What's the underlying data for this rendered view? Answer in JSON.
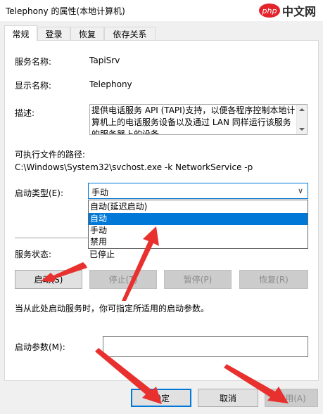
{
  "window": {
    "title": "Telephony 的属性(本地计算机)",
    "watermark": {
      "logo": "php",
      "text": "中文网"
    }
  },
  "tabs": [
    {
      "label": "常规",
      "active": true
    },
    {
      "label": "登录",
      "active": false
    },
    {
      "label": "恢复",
      "active": false
    },
    {
      "label": "依存关系",
      "active": false
    }
  ],
  "general": {
    "service_name_label": "服务名称:",
    "service_name": "TapiSrv",
    "display_name_label": "显示名称:",
    "display_name": "Telephony",
    "description_label": "描述:",
    "description": "提供电话服务 API (TAPI)支持，以便各程序控制本地计算机上的电话服务设备以及通过 LAN 同样运行该服务的服务器上的设备",
    "exe_path_label": "可执行文件的路径:",
    "exe_path": "C:\\Windows\\System32\\svchost.exe -k NetworkService -p",
    "startup_type_label": "启动类型(E):",
    "startup_type_value": "手动",
    "startup_options": [
      "自动(延迟启动)",
      "自动",
      "手动",
      "禁用"
    ],
    "startup_highlighted": "自动",
    "service_status_label": "服务状态:",
    "service_status": "已停止",
    "start_hint": "当从此处启动服务时，你可指定所适用的启动参数。",
    "start_params_label": "启动参数(M):",
    "start_params_value": ""
  },
  "service_buttons": {
    "start": "启动(S)",
    "stop": "停止(T)",
    "pause": "暂停(P)",
    "resume": "恢复(R)"
  },
  "dialog_buttons": {
    "ok": "确定",
    "cancel": "取消",
    "apply": "应用(A)"
  },
  "colors": {
    "accent": "#0078d7",
    "annotation_arrow": "#e8312f"
  }
}
